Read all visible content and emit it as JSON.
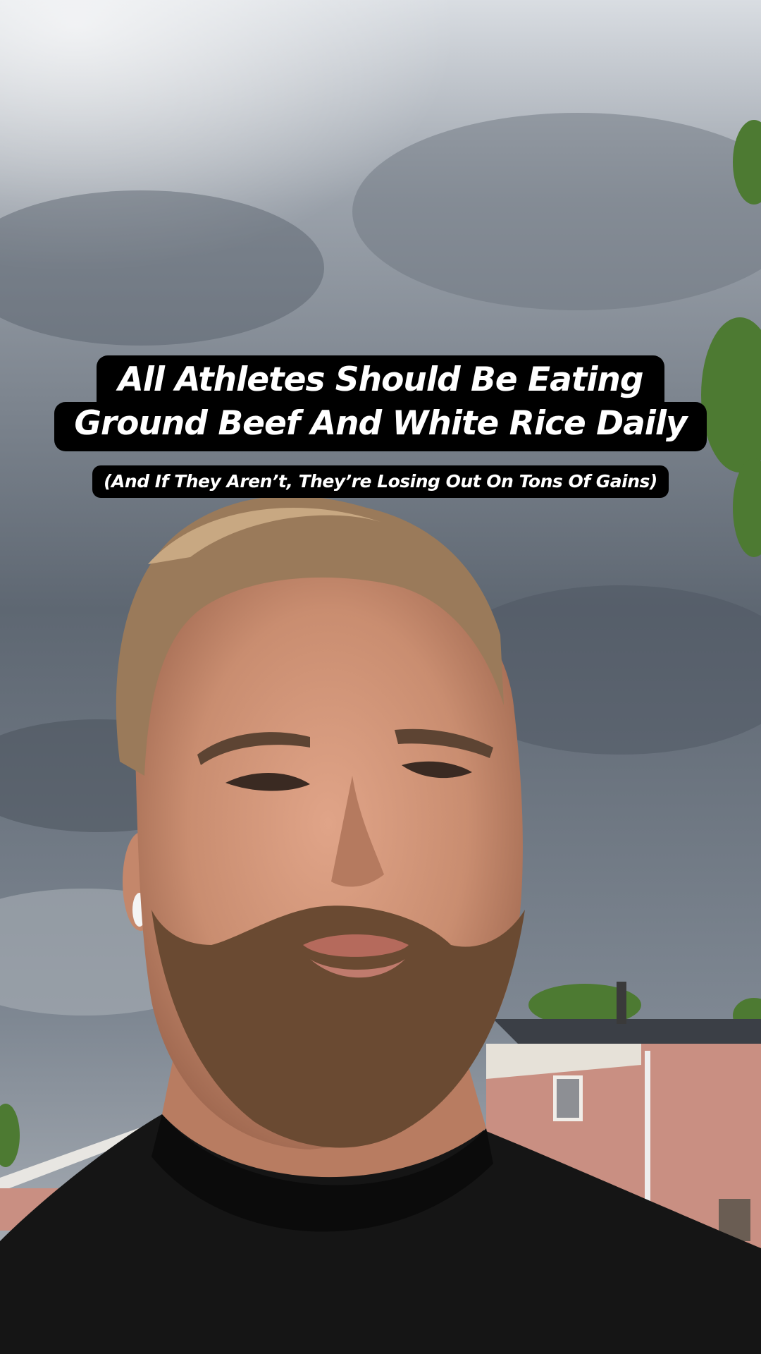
{
  "video": {
    "title_lines": [
      "All Athletes Should Be Eating",
      "Ground Beef And White Rice Daily"
    ],
    "subtitle": "(And If They Aren’t, They’re Losing Out On Tons Of Gains)"
  },
  "colors": {
    "caption_bg": "#000000",
    "caption_text": "#ffffff",
    "sky": "#5f6873",
    "shirt": "#151515",
    "skin": "#c98d70",
    "hair": "#9a7a5a",
    "beard": "#6a4a32",
    "house_brick": "#c98f82",
    "foliage": "#4d7a32"
  }
}
